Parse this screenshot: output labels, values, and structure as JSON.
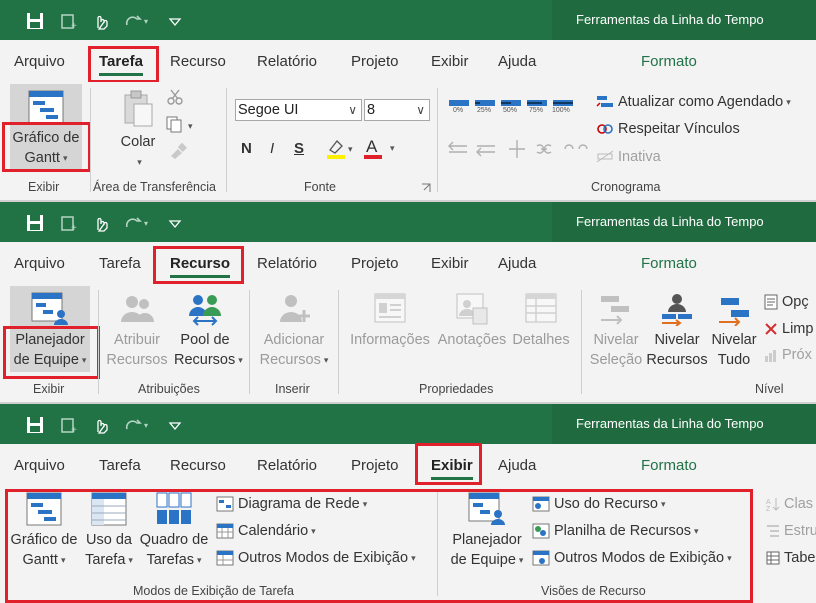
{
  "app_title": "Ferramentas da Linha do Tempo",
  "tabs": [
    "Arquivo",
    "Tarefa",
    "Recurso",
    "Relatório",
    "Projeto",
    "Exibir",
    "Ajuda",
    "Formato"
  ],
  "panel1": {
    "active_tab": "Tarefa",
    "gantt_label_1": "Gráfico de",
    "gantt_label_2": "Gantt",
    "exibir_group": "Exibir",
    "colar_label": "Colar",
    "clipboard_group": "Área de Transferência",
    "font_name": "Segoe UI",
    "font_size": "8",
    "bold": "N",
    "italic": "I",
    "underline": "S",
    "font_color_letter": "A",
    "font_group": "Fonte",
    "progress_labels": [
      "0%",
      "25%",
      "50%",
      "75%",
      "100%"
    ],
    "update_schedule": "Atualizar como Agendado",
    "respect_links": "Respeitar Vínculos",
    "inactive": "Inativa",
    "schedule_group": "Cronograma"
  },
  "panel2": {
    "active_tab": "Recurso",
    "team_planner_1": "Planejador",
    "team_planner_2": "de Equipe",
    "exibir_group": "Exibir",
    "assign_1": "Atribuir",
    "assign_2": "Recursos",
    "pool_1": "Pool de",
    "pool_2": "Recursos",
    "assignments_group": "Atribuições",
    "add_1": "Adicionar",
    "add_2": "Recursos",
    "insert_group": "Inserir",
    "info": "Informações",
    "notes": "Anotações",
    "details": "Detalhes",
    "properties_group": "Propriedades",
    "level_sel_1": "Nivelar",
    "level_sel_2": "Seleção",
    "level_res_1": "Nivelar",
    "level_res_2": "Recursos",
    "level_all_1": "Nivelar",
    "level_all_2": "Tudo",
    "opt": "Opç",
    "clear": "Limp",
    "next": "Próx",
    "level_group": "Nível"
  },
  "panel3": {
    "active_tab": "Exibir",
    "gantt_1": "Gráfico de",
    "gantt_2": "Gantt",
    "usage_1": "Uso da",
    "usage_2": "Tarefa",
    "board_1": "Quadro de",
    "board_2": "Tarefas",
    "network": "Diagrama de Rede",
    "calendar": "Calendário",
    "other_views": "Outros Modos de Exibição",
    "task_views_group": "Modos de Exibição de Tarefa",
    "team_planner_1": "Planejador",
    "team_planner_2": "de Equipe",
    "resource_usage": "Uso do Recurso",
    "resource_sheet": "Planilha de Recursos",
    "other_views_2": "Outros Modos de Exibição",
    "resource_views_group": "Visões de Recurso",
    "sort": "Clas",
    "outline": "Estru",
    "tables": "Tabe"
  },
  "colors": {
    "title_green": "#217346",
    "highlight_red": "#e0202a",
    "icon_blue": "#2b73c4"
  }
}
